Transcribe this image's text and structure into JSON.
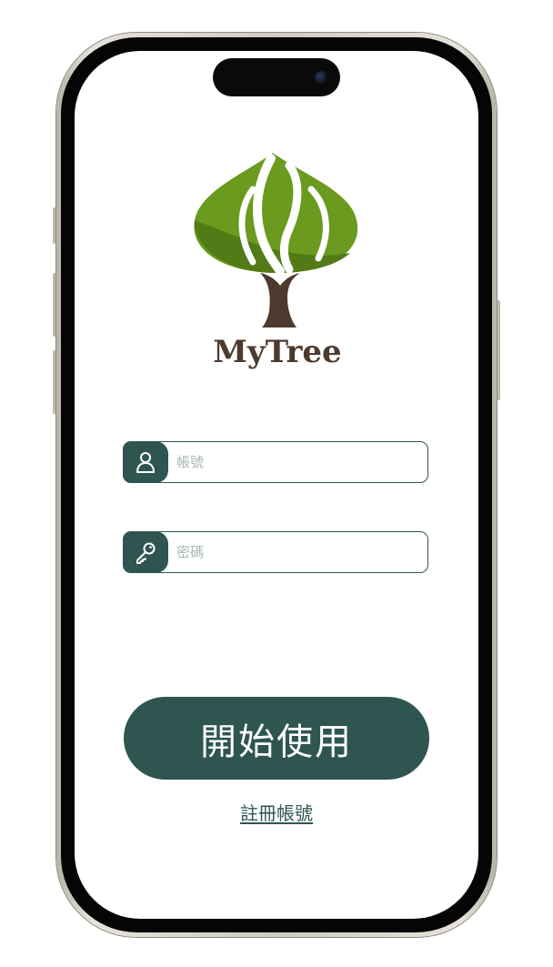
{
  "app": {
    "logo_text": "MyTree"
  },
  "login": {
    "account_placeholder": "帳號",
    "password_placeholder": "密碼",
    "start_button_label": "開始使用",
    "register_link_label": "註冊帳號"
  },
  "icons": {
    "account": "user-icon",
    "password": "key-icon"
  },
  "colors": {
    "primary": "#2f5550",
    "leaf_light": "#6a9a1e",
    "leaf_dark": "#527a16",
    "trunk": "#4d3a2e",
    "placeholder": "#a9b7b3"
  }
}
